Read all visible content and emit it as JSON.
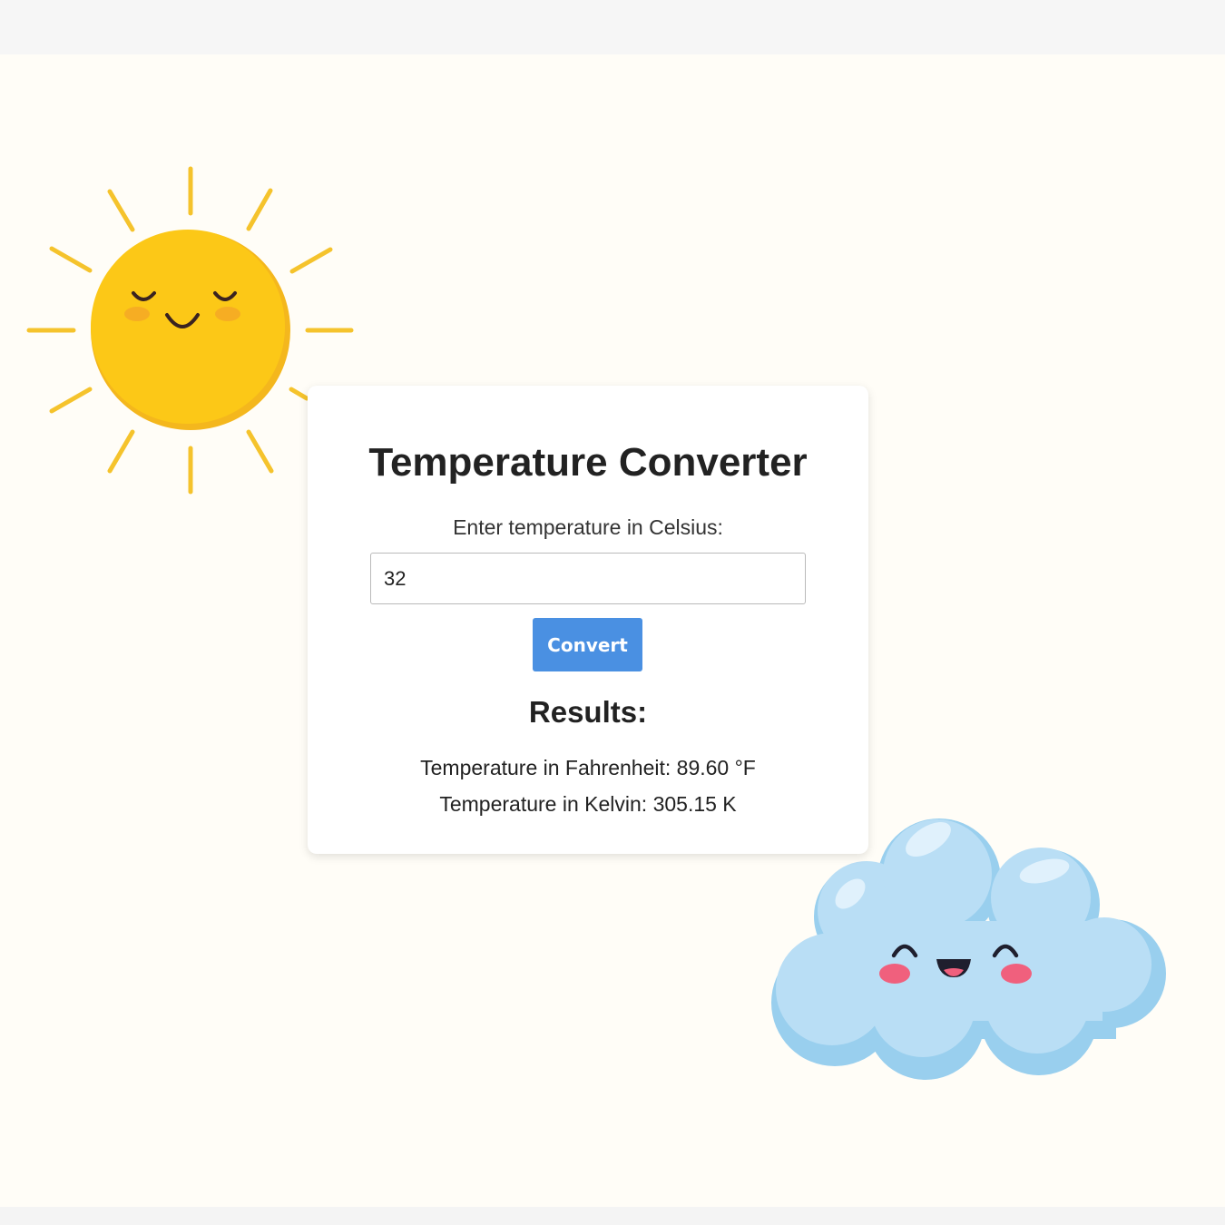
{
  "app": {
    "title": "Temperature Converter"
  },
  "form": {
    "label": "Enter temperature in Celsius:",
    "value": "32",
    "button_label": "Convert"
  },
  "results": {
    "heading": "Results:",
    "fahrenheit": "Temperature in Fahrenheit: 89.60 °F",
    "kelvin": "Temperature in Kelvin: 305.15 K"
  },
  "decorations": {
    "sun_icon": "smiling-sun",
    "cloud_icon": "smiling-cloud"
  },
  "colors": {
    "accent": "#4a90e2",
    "sun": "#fcc419",
    "cloud": "#b6ddf5"
  }
}
